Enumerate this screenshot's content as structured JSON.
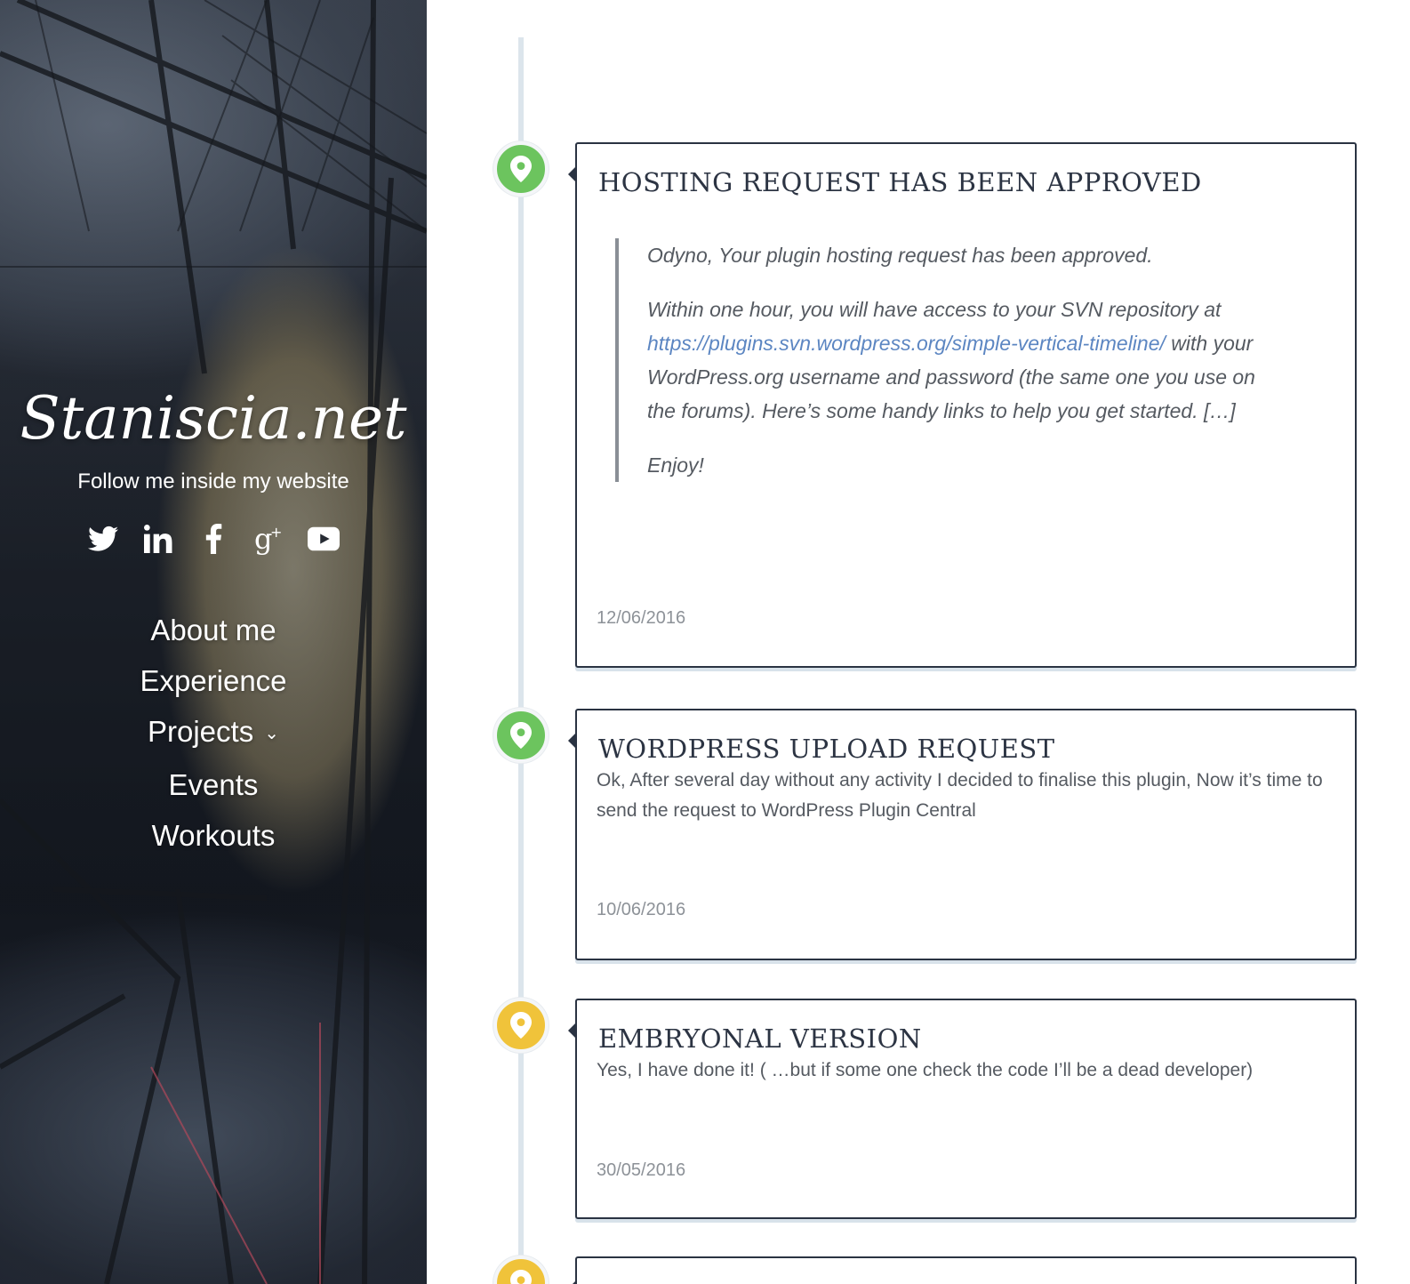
{
  "sidebar": {
    "site_title": "Staniscia.net",
    "tagline": "Follow me inside my website",
    "social": [
      {
        "icon": "twitter-icon"
      },
      {
        "icon": "linkedin-icon"
      },
      {
        "icon": "facebook-icon"
      },
      {
        "icon": "google-plus-icon"
      },
      {
        "icon": "youtube-icon"
      }
    ],
    "nav": [
      {
        "label": "About me"
      },
      {
        "label": "Experience"
      },
      {
        "label": "Projects",
        "has_submenu": true
      },
      {
        "label": "Events"
      },
      {
        "label": "Workouts"
      }
    ]
  },
  "timeline": {
    "entries": [
      {
        "title": "Hosting request has been approved",
        "marker_color": "#6cc45e",
        "quote": {
          "p1": "Odyno, Your plugin hosting request has been approved.",
          "p2_before": "Within one hour, you will have access to your SVN repository at",
          "link": "https://plugins.svn.wordpress.org/simple-vertical-timeline/",
          "p2_after": "with your WordPress.org username and password (the same one you use on the forums). Here’s some handy links to help you get started. […]",
          "p3": "Enjoy!"
        },
        "date": "12/06/2016"
      },
      {
        "title": "WordPress Upload Request",
        "marker_color": "#6cc45e",
        "text": "Ok, After several day without any activity I decided to finalise this plugin, Now it’s time to send the request to WordPress Plugin Central",
        "date": "10/06/2016"
      },
      {
        "title": "Embryonal version",
        "marker_color": "#f0c33a",
        "text": "Yes, I have done it! ( …but if some one check the code I’ll be a dead developer)",
        "date": "30/05/2016"
      }
    ]
  },
  "colors": {
    "timeline_line": "#dce5ec",
    "card_border": "#2a3342",
    "link": "#5c86c2",
    "marker_green": "#6cc45e",
    "marker_yellow": "#f0c33a"
  }
}
